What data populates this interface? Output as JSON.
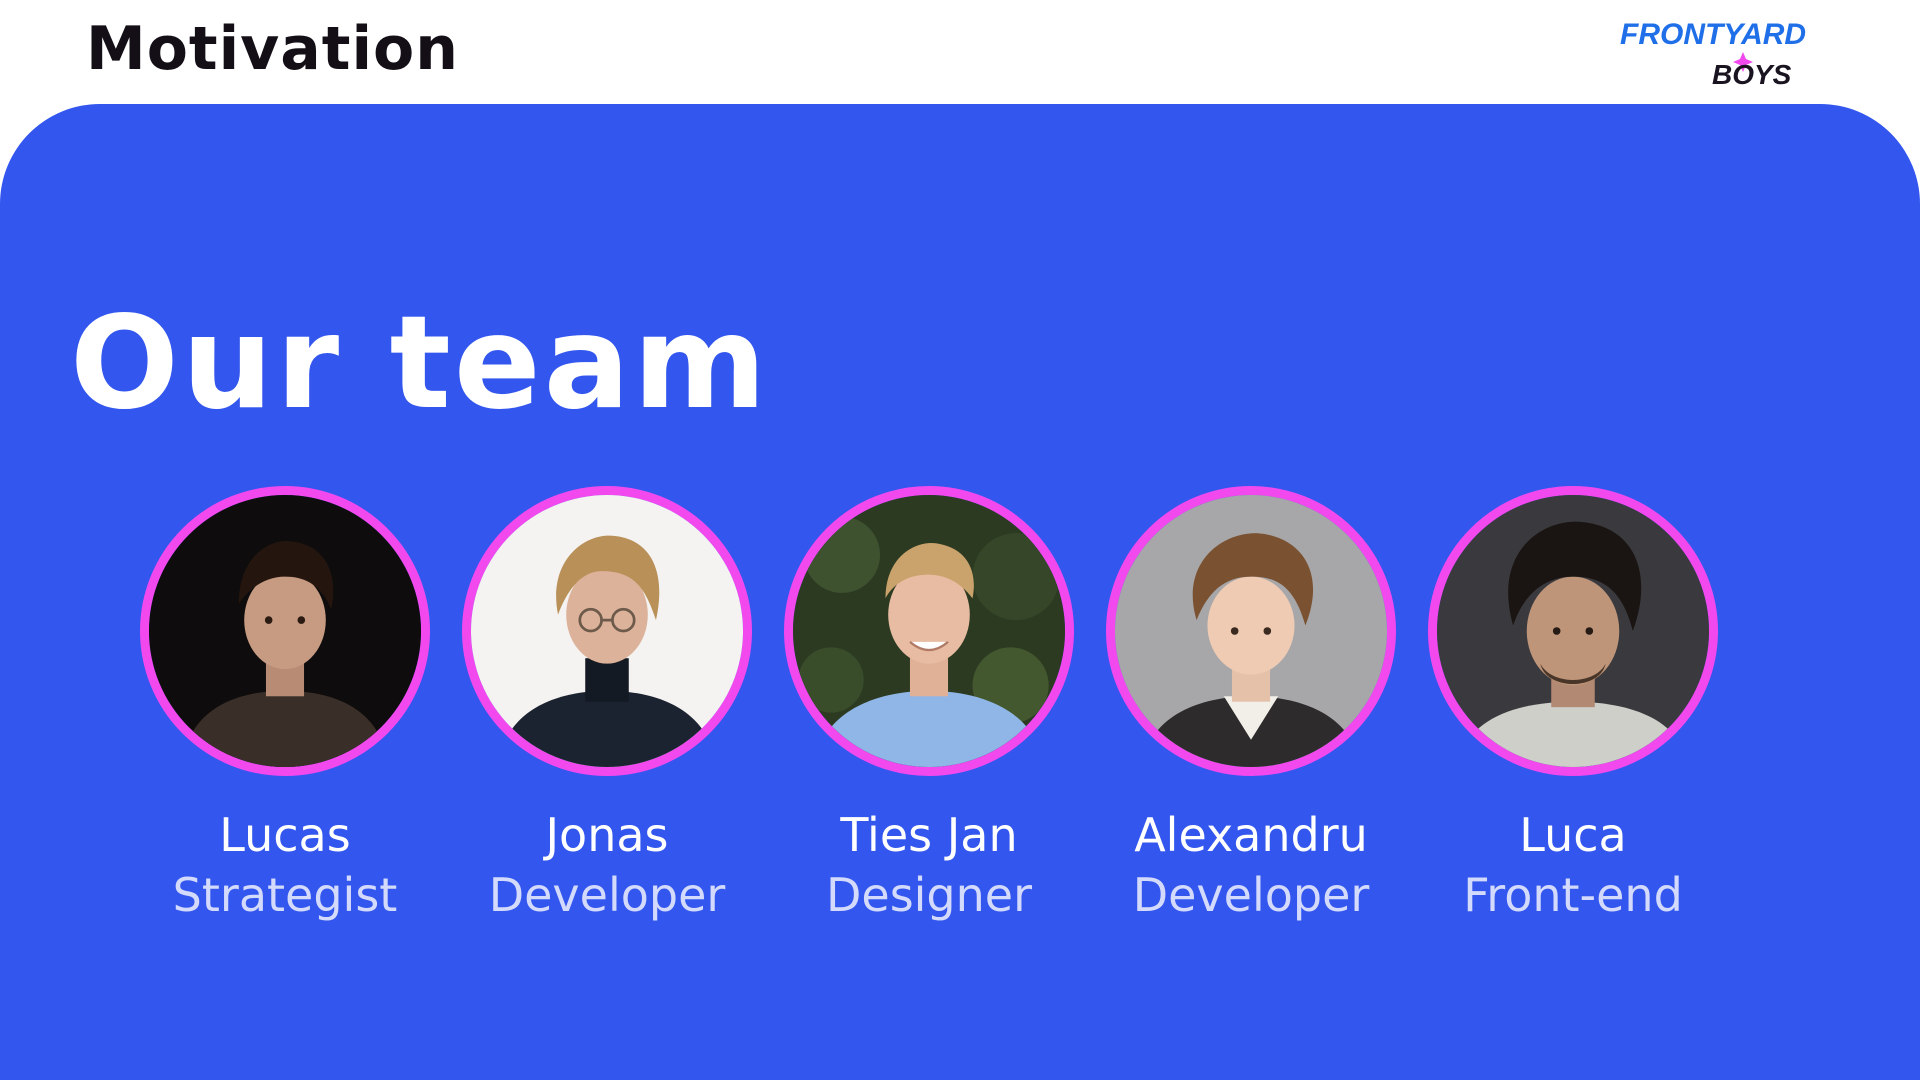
{
  "header": {
    "section_title": "Motivation",
    "logo": {
      "line1": "FRONTYARD",
      "line2": "BOYS",
      "icon": "sparkle-icon"
    }
  },
  "main": {
    "heading": "Our team",
    "members": [
      {
        "name": "Lucas",
        "role": "Strategist",
        "photo": "portrait-lucas"
      },
      {
        "name": "Jonas",
        "role": "Developer",
        "photo": "portrait-jonas"
      },
      {
        "name": "Ties Jan",
        "role": "Designer",
        "photo": "portrait-ties-jan"
      },
      {
        "name": "Alexandru",
        "role": "Developer",
        "photo": "portrait-alexandru"
      },
      {
        "name": "Luca",
        "role": "Front-end",
        "photo": "portrait-luca"
      }
    ]
  },
  "colors": {
    "panel": "#3256ee",
    "portrait_ring": "#f149ee",
    "role_text": "#d3dafc",
    "title_text": "#140f17",
    "logo_blue": "#1f6fe8",
    "logo_dark": "#1a1420"
  }
}
